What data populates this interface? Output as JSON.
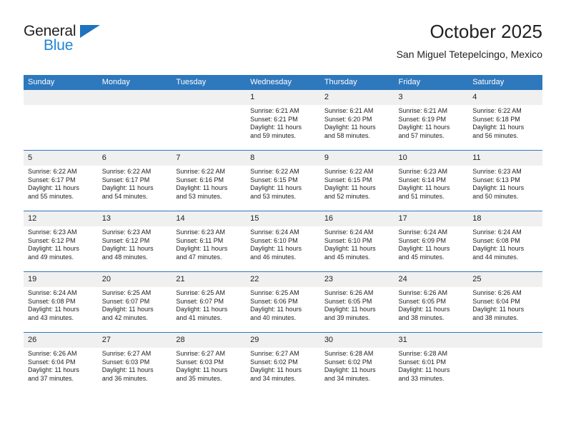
{
  "brand": {
    "name_part1": "General",
    "name_part2": "Blue",
    "triangle_color": "#1f72bd",
    "blue_color": "#1f84d6"
  },
  "header": {
    "title": "October 2025",
    "subtitle": "San Miguel Tetepelcingo, Mexico"
  },
  "theme": {
    "header_bg": "#2e78bd",
    "header_text": "#ffffff",
    "daynum_bg": "#f0f0f0",
    "cell_bg": "#ffffff",
    "row_border": "#2e78bd"
  },
  "weekdays": [
    "Sunday",
    "Monday",
    "Tuesday",
    "Wednesday",
    "Thursday",
    "Friday",
    "Saturday"
  ],
  "labels": {
    "sunrise_prefix": "Sunrise:",
    "sunset_prefix": "Sunset:",
    "daylight_prefix": "Daylight:"
  },
  "weeks": [
    [
      {
        "day": "",
        "sunrise": "",
        "sunset": "",
        "daylight_line1": "",
        "daylight_line2": ""
      },
      {
        "day": "",
        "sunrise": "",
        "sunset": "",
        "daylight_line1": "",
        "daylight_line2": ""
      },
      {
        "day": "",
        "sunrise": "",
        "sunset": "",
        "daylight_line1": "",
        "daylight_line2": ""
      },
      {
        "day": "1",
        "sunrise": "Sunrise: 6:21 AM",
        "sunset": "Sunset: 6:21 PM",
        "daylight_line1": "Daylight: 11 hours",
        "daylight_line2": "and 59 minutes."
      },
      {
        "day": "2",
        "sunrise": "Sunrise: 6:21 AM",
        "sunset": "Sunset: 6:20 PM",
        "daylight_line1": "Daylight: 11 hours",
        "daylight_line2": "and 58 minutes."
      },
      {
        "day": "3",
        "sunrise": "Sunrise: 6:21 AM",
        "sunset": "Sunset: 6:19 PM",
        "daylight_line1": "Daylight: 11 hours",
        "daylight_line2": "and 57 minutes."
      },
      {
        "day": "4",
        "sunrise": "Sunrise: 6:22 AM",
        "sunset": "Sunset: 6:18 PM",
        "daylight_line1": "Daylight: 11 hours",
        "daylight_line2": "and 56 minutes."
      }
    ],
    [
      {
        "day": "5",
        "sunrise": "Sunrise: 6:22 AM",
        "sunset": "Sunset: 6:17 PM",
        "daylight_line1": "Daylight: 11 hours",
        "daylight_line2": "and 55 minutes."
      },
      {
        "day": "6",
        "sunrise": "Sunrise: 6:22 AM",
        "sunset": "Sunset: 6:17 PM",
        "daylight_line1": "Daylight: 11 hours",
        "daylight_line2": "and 54 minutes."
      },
      {
        "day": "7",
        "sunrise": "Sunrise: 6:22 AM",
        "sunset": "Sunset: 6:16 PM",
        "daylight_line1": "Daylight: 11 hours",
        "daylight_line2": "and 53 minutes."
      },
      {
        "day": "8",
        "sunrise": "Sunrise: 6:22 AM",
        "sunset": "Sunset: 6:15 PM",
        "daylight_line1": "Daylight: 11 hours",
        "daylight_line2": "and 53 minutes."
      },
      {
        "day": "9",
        "sunrise": "Sunrise: 6:22 AM",
        "sunset": "Sunset: 6:15 PM",
        "daylight_line1": "Daylight: 11 hours",
        "daylight_line2": "and 52 minutes."
      },
      {
        "day": "10",
        "sunrise": "Sunrise: 6:23 AM",
        "sunset": "Sunset: 6:14 PM",
        "daylight_line1": "Daylight: 11 hours",
        "daylight_line2": "and 51 minutes."
      },
      {
        "day": "11",
        "sunrise": "Sunrise: 6:23 AM",
        "sunset": "Sunset: 6:13 PM",
        "daylight_line1": "Daylight: 11 hours",
        "daylight_line2": "and 50 minutes."
      }
    ],
    [
      {
        "day": "12",
        "sunrise": "Sunrise: 6:23 AM",
        "sunset": "Sunset: 6:12 PM",
        "daylight_line1": "Daylight: 11 hours",
        "daylight_line2": "and 49 minutes."
      },
      {
        "day": "13",
        "sunrise": "Sunrise: 6:23 AM",
        "sunset": "Sunset: 6:12 PM",
        "daylight_line1": "Daylight: 11 hours",
        "daylight_line2": "and 48 minutes."
      },
      {
        "day": "14",
        "sunrise": "Sunrise: 6:23 AM",
        "sunset": "Sunset: 6:11 PM",
        "daylight_line1": "Daylight: 11 hours",
        "daylight_line2": "and 47 minutes."
      },
      {
        "day": "15",
        "sunrise": "Sunrise: 6:24 AM",
        "sunset": "Sunset: 6:10 PM",
        "daylight_line1": "Daylight: 11 hours",
        "daylight_line2": "and 46 minutes."
      },
      {
        "day": "16",
        "sunrise": "Sunrise: 6:24 AM",
        "sunset": "Sunset: 6:10 PM",
        "daylight_line1": "Daylight: 11 hours",
        "daylight_line2": "and 45 minutes."
      },
      {
        "day": "17",
        "sunrise": "Sunrise: 6:24 AM",
        "sunset": "Sunset: 6:09 PM",
        "daylight_line1": "Daylight: 11 hours",
        "daylight_line2": "and 45 minutes."
      },
      {
        "day": "18",
        "sunrise": "Sunrise: 6:24 AM",
        "sunset": "Sunset: 6:08 PM",
        "daylight_line1": "Daylight: 11 hours",
        "daylight_line2": "and 44 minutes."
      }
    ],
    [
      {
        "day": "19",
        "sunrise": "Sunrise: 6:24 AM",
        "sunset": "Sunset: 6:08 PM",
        "daylight_line1": "Daylight: 11 hours",
        "daylight_line2": "and 43 minutes."
      },
      {
        "day": "20",
        "sunrise": "Sunrise: 6:25 AM",
        "sunset": "Sunset: 6:07 PM",
        "daylight_line1": "Daylight: 11 hours",
        "daylight_line2": "and 42 minutes."
      },
      {
        "day": "21",
        "sunrise": "Sunrise: 6:25 AM",
        "sunset": "Sunset: 6:07 PM",
        "daylight_line1": "Daylight: 11 hours",
        "daylight_line2": "and 41 minutes."
      },
      {
        "day": "22",
        "sunrise": "Sunrise: 6:25 AM",
        "sunset": "Sunset: 6:06 PM",
        "daylight_line1": "Daylight: 11 hours",
        "daylight_line2": "and 40 minutes."
      },
      {
        "day": "23",
        "sunrise": "Sunrise: 6:26 AM",
        "sunset": "Sunset: 6:05 PM",
        "daylight_line1": "Daylight: 11 hours",
        "daylight_line2": "and 39 minutes."
      },
      {
        "day": "24",
        "sunrise": "Sunrise: 6:26 AM",
        "sunset": "Sunset: 6:05 PM",
        "daylight_line1": "Daylight: 11 hours",
        "daylight_line2": "and 38 minutes."
      },
      {
        "day": "25",
        "sunrise": "Sunrise: 6:26 AM",
        "sunset": "Sunset: 6:04 PM",
        "daylight_line1": "Daylight: 11 hours",
        "daylight_line2": "and 38 minutes."
      }
    ],
    [
      {
        "day": "26",
        "sunrise": "Sunrise: 6:26 AM",
        "sunset": "Sunset: 6:04 PM",
        "daylight_line1": "Daylight: 11 hours",
        "daylight_line2": "and 37 minutes."
      },
      {
        "day": "27",
        "sunrise": "Sunrise: 6:27 AM",
        "sunset": "Sunset: 6:03 PM",
        "daylight_line1": "Daylight: 11 hours",
        "daylight_line2": "and 36 minutes."
      },
      {
        "day": "28",
        "sunrise": "Sunrise: 6:27 AM",
        "sunset": "Sunset: 6:03 PM",
        "daylight_line1": "Daylight: 11 hours",
        "daylight_line2": "and 35 minutes."
      },
      {
        "day": "29",
        "sunrise": "Sunrise: 6:27 AM",
        "sunset": "Sunset: 6:02 PM",
        "daylight_line1": "Daylight: 11 hours",
        "daylight_line2": "and 34 minutes."
      },
      {
        "day": "30",
        "sunrise": "Sunrise: 6:28 AM",
        "sunset": "Sunset: 6:02 PM",
        "daylight_line1": "Daylight: 11 hours",
        "daylight_line2": "and 34 minutes."
      },
      {
        "day": "31",
        "sunrise": "Sunrise: 6:28 AM",
        "sunset": "Sunset: 6:01 PM",
        "daylight_line1": "Daylight: 11 hours",
        "daylight_line2": "and 33 minutes."
      },
      {
        "day": "",
        "sunrise": "",
        "sunset": "",
        "daylight_line1": "",
        "daylight_line2": ""
      }
    ]
  ]
}
